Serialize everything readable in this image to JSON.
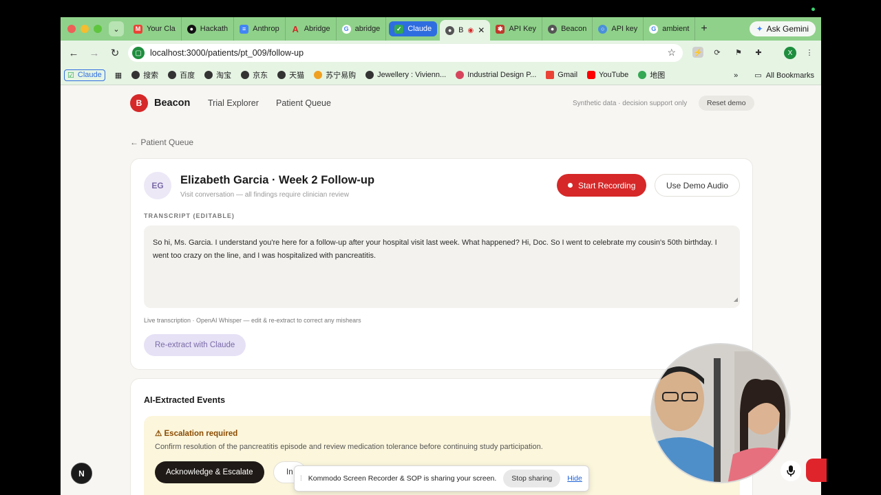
{
  "browser": {
    "tabs": [
      {
        "label": "Your Cla",
        "icon": "gmail-icon"
      },
      {
        "label": "Hackath",
        "icon": "github-icon"
      },
      {
        "label": "Anthrop",
        "icon": "docs-icon"
      },
      {
        "label": "Abridge",
        "icon": "abridge-icon"
      },
      {
        "label": "abridge",
        "icon": "google-icon"
      },
      {
        "label": "Claude",
        "icon": "claude-icon"
      },
      {
        "label": "B",
        "icon": "beacon-icon"
      },
      {
        "label": "API Key",
        "icon": "api-icon"
      },
      {
        "label": "Beacon",
        "icon": "globe-icon"
      },
      {
        "label": "API key",
        "icon": "globe-icon"
      },
      {
        "label": "ambient",
        "icon": "google-icon"
      }
    ],
    "ask_gemini": "Ask Gemini",
    "url": "localhost:3000/patients/pt_009/follow-up",
    "profile_initial": "X",
    "bookmarks": [
      "Claude",
      "搜索",
      "百度",
      "淘宝",
      "京东",
      "天猫",
      "苏宁易购",
      "Jewellery : Vivienn...",
      "Industrial Design P...",
      "Gmail",
      "YouTube",
      "地图"
    ],
    "all_bookmarks": "All Bookmarks"
  },
  "app": {
    "brand_initial": "B",
    "brand_name": "Beacon",
    "nav": [
      "Trial Explorer",
      "Patient Queue"
    ],
    "synthetic_note": "Synthetic data · decision support only",
    "reset_label": "Reset demo",
    "back_link": "← Patient Queue"
  },
  "visit": {
    "initials": "EG",
    "title": "Elizabeth Garcia · Week 2 Follow-up",
    "subtitle": "Visit conversation — all findings require clinician review",
    "start_recording": "Start Recording",
    "use_demo_audio": "Use Demo Audio",
    "transcript_label": "TRANSCRIPT (EDITABLE)",
    "transcript": "So hi, Ms. Garcia. I understand you're here for a follow-up after your hospital visit last week. What happened? Hi, Doc. So I went to celebrate my cousin's 50th birthday. I went too crazy on the line, and I was hospitalized with pancreatitis.",
    "live_note": "Live transcription · OpenAI Whisper — edit & re-extract to correct any mishears",
    "reextract": "Re-extract with Claude"
  },
  "events": {
    "title": "AI-Extracted Events",
    "escalation_title": "⚠ Escalation required",
    "escalation_text": "Confirm resolution of the pancreatitis episode and review medication tolerance before continuing study participation.",
    "ack_label": "Acknowledge & Escalate",
    "second_label": "In"
  },
  "overlays": {
    "next_badge": "N",
    "share_message": "Kommodo Screen Recorder & SOP is sharing your screen.",
    "stop_sharing": "Stop sharing",
    "hide": "Hide"
  },
  "colors": {
    "brand_red": "#d62828",
    "tab_strip": "#8fd18a",
    "escalation_bg": "#fbf6dc",
    "reextract_bg": "#e6e1f5"
  }
}
